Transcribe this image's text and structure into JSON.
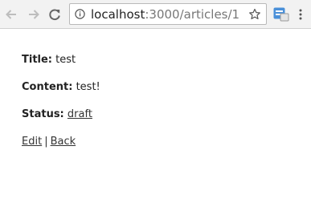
{
  "browser": {
    "url_host": "localhost",
    "url_path": ":3000/articles/1",
    "icons": {
      "back": "back-arrow-icon",
      "forward": "forward-arrow-icon",
      "reload": "reload-icon",
      "info": "info-icon",
      "bookmark": "star-icon",
      "extension": "extension-icon",
      "menu": "kebab-menu-icon"
    }
  },
  "article": {
    "title_label": "Title:",
    "title_value": "test",
    "content_label": "Content:",
    "content_value": "test!",
    "status_label": "Status:",
    "status_value": "draft"
  },
  "actions": {
    "edit": "Edit",
    "separator": "|",
    "back": "Back"
  },
  "colors": {
    "toolbar_bg": "#f2f2f2",
    "text": "#222222",
    "link": "#333333"
  }
}
